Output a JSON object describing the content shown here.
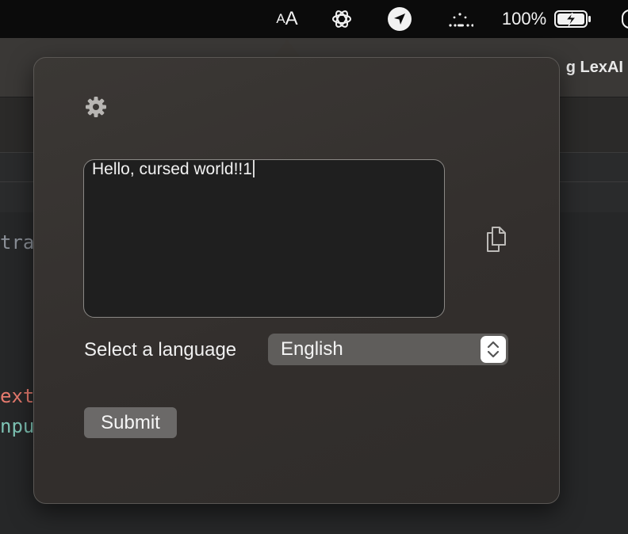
{
  "menubar": {
    "text_size_small": "A",
    "text_size_large": "A",
    "battery_percent": "100%",
    "icons": [
      "text-size-icon",
      "chatgpt-icon",
      "location-arrow-icon",
      "control-center-icon",
      "battery-icon"
    ]
  },
  "background_window": {
    "title_fragment": "g LexAI",
    "code_fragments": [
      "tra",
      "ext",
      "npu"
    ]
  },
  "popover": {
    "input_text": "Hello, cursed world!!1",
    "language_label": "Select a language",
    "selected_language": "English",
    "submit_label": "Submit"
  },
  "colors": {
    "popover_bg": "#36322f",
    "textarea_bg": "#1f1f1f",
    "select_bg": "#5f5d5b",
    "button_bg": "#6b6968"
  }
}
